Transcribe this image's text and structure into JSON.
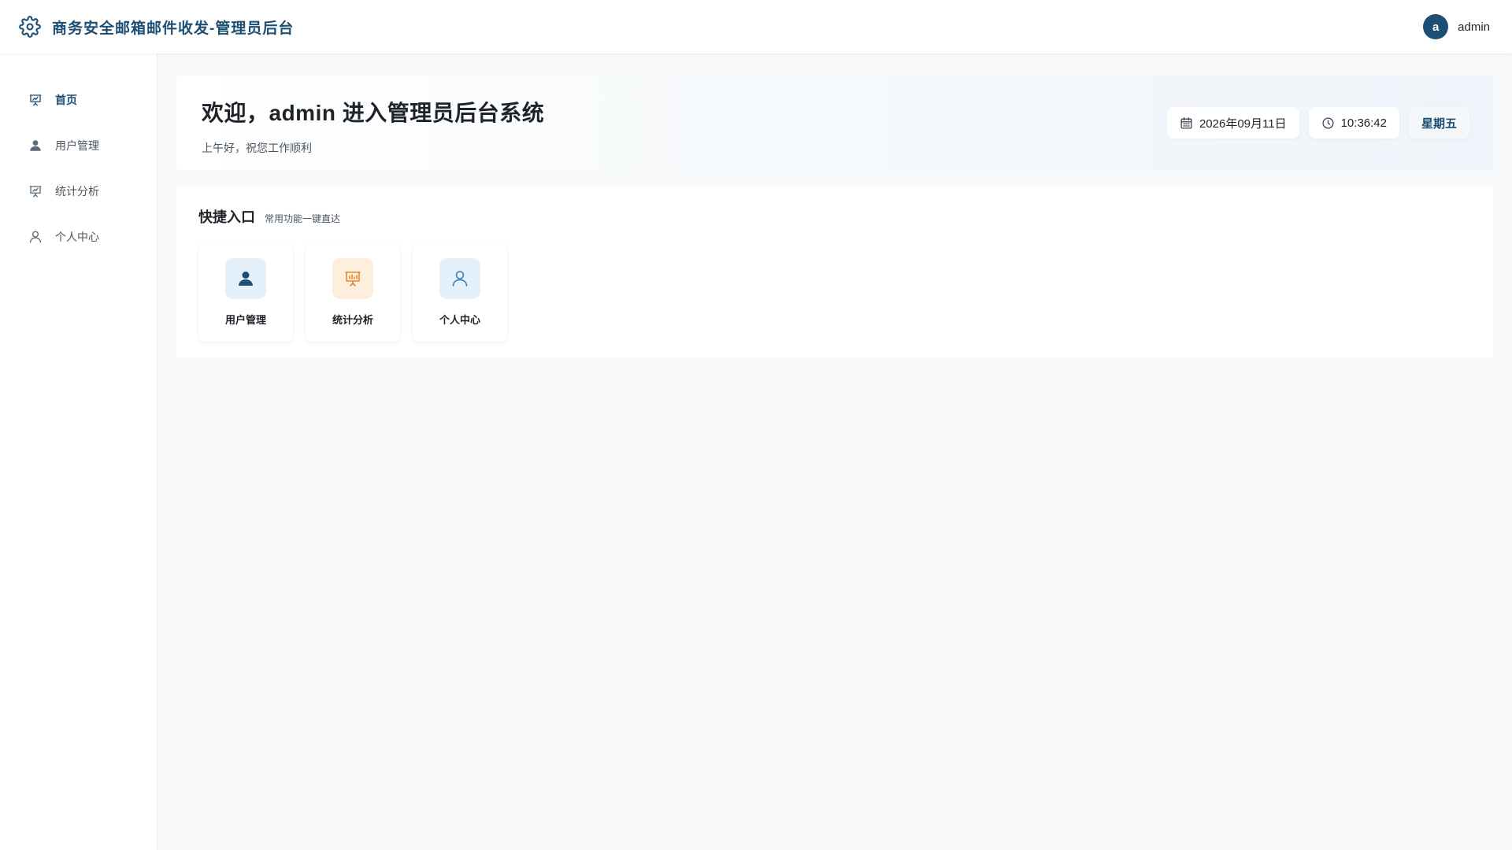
{
  "header": {
    "title": "商务安全邮箱邮件收发-管理员后台",
    "logo_icon": "gear-icon",
    "user": {
      "avatar_letter": "a",
      "name": "admin"
    }
  },
  "sidebar": {
    "items": [
      {
        "label": "首页",
        "icon": "presentation-chart-icon",
        "active": true
      },
      {
        "label": "用户管理",
        "icon": "user-filled-icon",
        "active": false
      },
      {
        "label": "统计分析",
        "icon": "presentation-chart-icon",
        "active": false
      },
      {
        "label": "个人中心",
        "icon": "user-outline-icon",
        "active": false
      }
    ]
  },
  "welcome": {
    "title": "欢迎，admin 进入管理员后台系统",
    "subtitle": "上午好，祝您工作顺利",
    "date": "2026年09月11日",
    "time": "10:36:42",
    "weekday": "星期五"
  },
  "quick": {
    "title": "快捷入口",
    "subtitle": "常用功能一键直达",
    "cards": [
      {
        "label": "用户管理",
        "icon": "user-filled-icon",
        "color": "#1d4e73"
      },
      {
        "label": "统计分析",
        "icon": "presentation-chart-icon",
        "color": "#e58a2b"
      },
      {
        "label": "个人中心",
        "icon": "user-outline-icon",
        "color": "#3b7fb3"
      }
    ]
  },
  "colors": {
    "brand": "#1d4e73",
    "background": "#f7f9fb",
    "accent_orange": "#e58a2b"
  }
}
